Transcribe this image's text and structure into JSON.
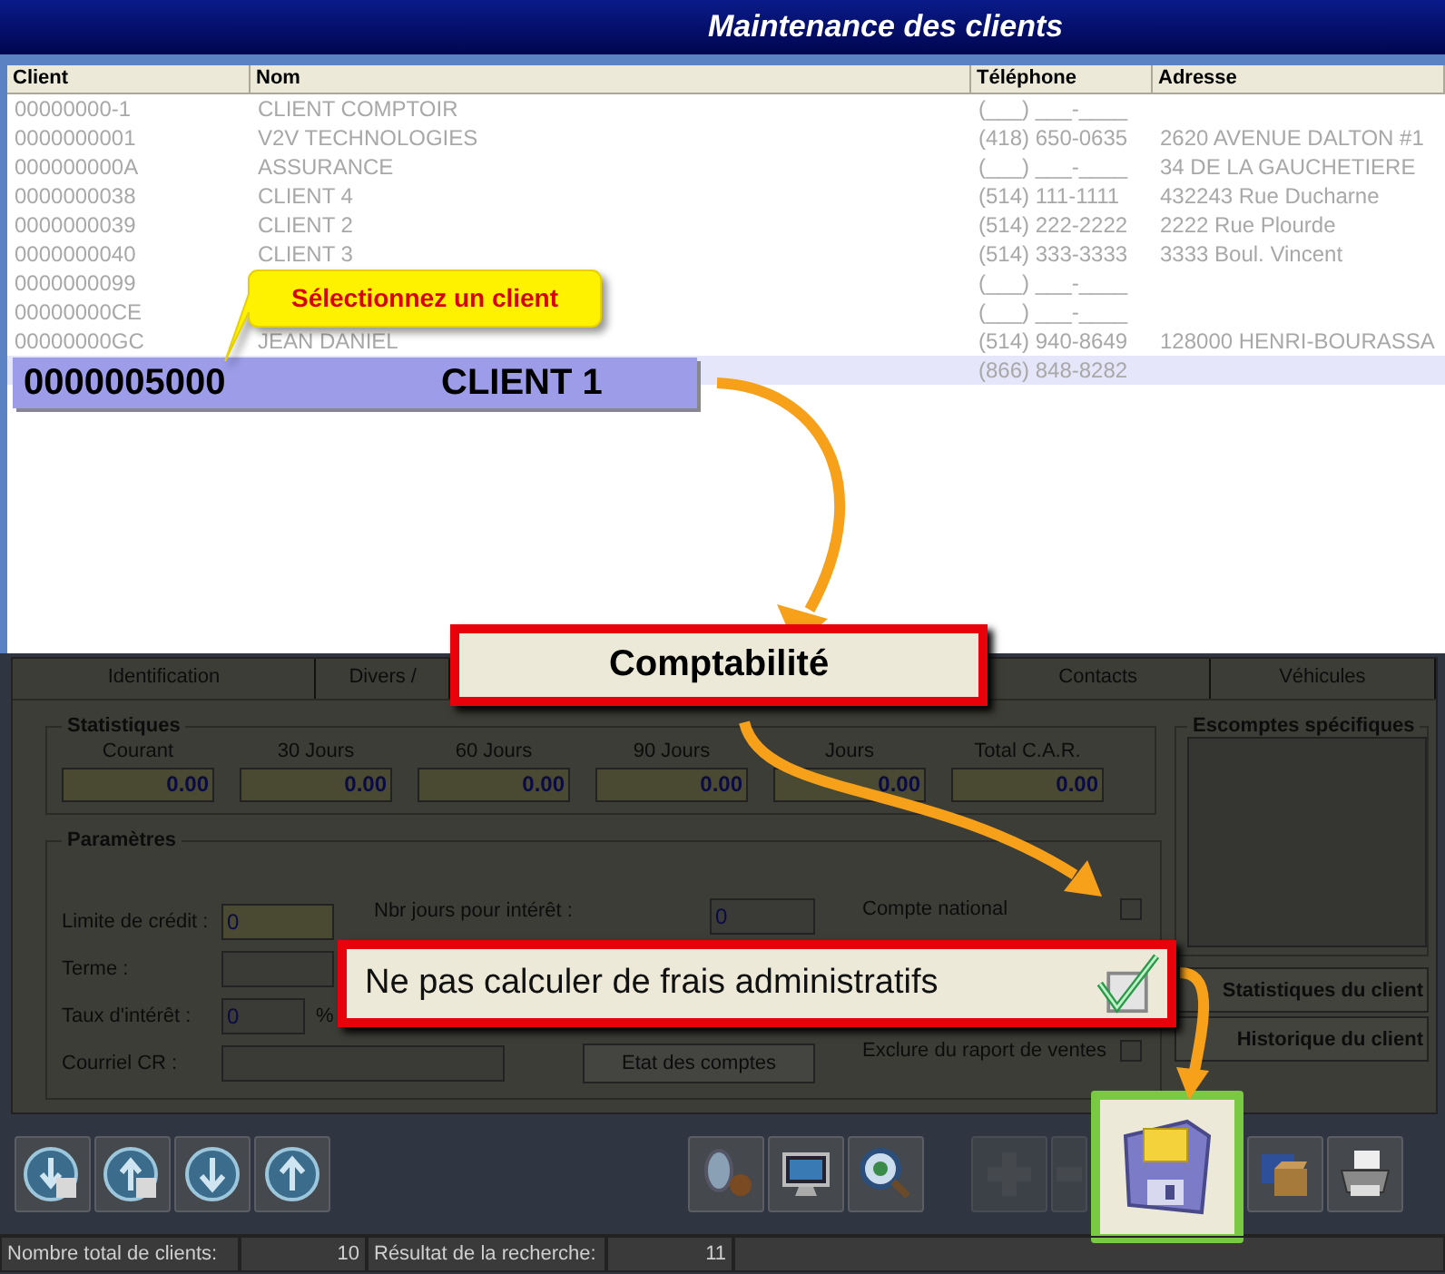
{
  "window": {
    "title": "Maintenance des clients"
  },
  "client_table": {
    "columns": [
      "Client",
      "Nom",
      "Téléphone",
      "Adresse"
    ],
    "rows": [
      {
        "client": "00000000-1",
        "nom": "CLIENT COMPTOIR",
        "telephone": "(___) ___-____",
        "selected": false
      },
      {
        "client": "0000000001",
        "nom": "V2V TECHNOLOGIES",
        "telephone": "(418) 650-0635",
        "adresse": "2620 AVENUE DALTON #1",
        "selected": false
      },
      {
        "client": "000000000A",
        "nom": "ASSURANCE",
        "telephone": "(___) ___-____",
        "adresse": "34 DE LA GAUCHETIERE",
        "selected": false
      },
      {
        "client": "0000000038",
        "nom": "CLIENT 4",
        "telephone": "(514) 111-1111",
        "adresse": "432243 Rue Ducharne",
        "selected": false
      },
      {
        "client": "0000000039",
        "nom": "CLIENT 2",
        "telephone": "(514) 222-2222",
        "adresse": "2222 Rue Plourde",
        "selected": false
      },
      {
        "client": "0000000040",
        "nom": "CLIENT 3",
        "telephone": "(514) 333-3333",
        "adresse": "3333 Boul. Vincent",
        "selected": false
      },
      {
        "client": "0000000099",
        "telephone": "(___) ___-____",
        "selected": false
      },
      {
        "client": "00000000CE",
        "telephone": "(___) ___-____",
        "selected": false
      },
      {
        "client": "00000000GC",
        "nom": "JEAN DANIEL",
        "telephone": "(514) 940-8649",
        "adresse": "128000 HENRI-BOURASSA",
        "selected": false
      },
      {
        "client": "0000005000",
        "nom": "CLIENT 1",
        "telephone": "(866) 848-8282",
        "selected": true
      }
    ]
  },
  "callout": {
    "text": "Sélectionnez un client"
  },
  "tabs": [
    {
      "label": "Identification",
      "selected": false
    },
    {
      "label": "Divers /",
      "selected": false
    },
    {
      "label": "Comptabilité",
      "selected": true
    },
    {
      "label": "Contacts",
      "selected": false
    },
    {
      "label": "Véhicules",
      "selected": false
    }
  ],
  "statistiques": {
    "title": "Statistiques",
    "fields": [
      {
        "label": "Courant",
        "value": "0.00"
      },
      {
        "label": "30 Jours",
        "value": "0.00"
      },
      {
        "label": "60 Jours",
        "value": "0.00"
      },
      {
        "label": "90 Jours",
        "value": "0.00"
      },
      {
        "label": "Jours",
        "value": "0.00"
      },
      {
        "label": "Total C.A.R.",
        "value": "0.00"
      }
    ]
  },
  "escomptes": {
    "title": "Escomptes spécifiques"
  },
  "parametres": {
    "title": "Paramètres",
    "fields": [
      {
        "label": "Limite de crédit :",
        "value": "0"
      },
      {
        "label": "Terme :"
      },
      {
        "label": "Taux d'intérêt :",
        "value": "0",
        "unit": "%"
      },
      {
        "label": "Courriel CR :"
      }
    ],
    "nbr_jours": {
      "label": "Nbr jours pour intérêt :",
      "value": "0"
    },
    "button": "Etat des comptes",
    "checkboxes": [
      {
        "label": "Compte national",
        "checked": false
      },
      {
        "label": "Exclure du raport de ventes",
        "checked": false
      }
    ]
  },
  "highlight_option": {
    "label": "Ne pas calculer de frais administratifs",
    "checked": true
  },
  "side_buttons": [
    "Statistiques du client",
    "Historique du client"
  ],
  "toolbar": [
    {
      "kind": "import",
      "disabled": false,
      "highlighted": false
    },
    {
      "kind": "export",
      "disabled": false,
      "highlighted": false
    },
    {
      "kind": "down",
      "disabled": false,
      "highlighted": false
    },
    {
      "kind": "up",
      "disabled": false,
      "highlighted": false
    },
    {
      "kind": "lookup",
      "disabled": false,
      "highlighted": false
    },
    {
      "kind": "display",
      "disabled": false,
      "highlighted": false
    },
    {
      "kind": "search",
      "disabled": false,
      "highlighted": false
    },
    {
      "kind": "add",
      "disabled": true,
      "highlighted": false
    },
    {
      "kind": "remove",
      "disabled": true,
      "highlighted": false
    },
    {
      "kind": "save",
      "disabled": false,
      "highlighted": true
    },
    {
      "kind": "archive",
      "disabled": false,
      "highlighted": false
    },
    {
      "kind": "print",
      "disabled": false,
      "highlighted": false
    }
  ],
  "status_bar": [
    {
      "label": "Nombre total de clients:",
      "value": "10"
    },
    {
      "label": "Résultat de la recherche:",
      "value": "11"
    }
  ]
}
